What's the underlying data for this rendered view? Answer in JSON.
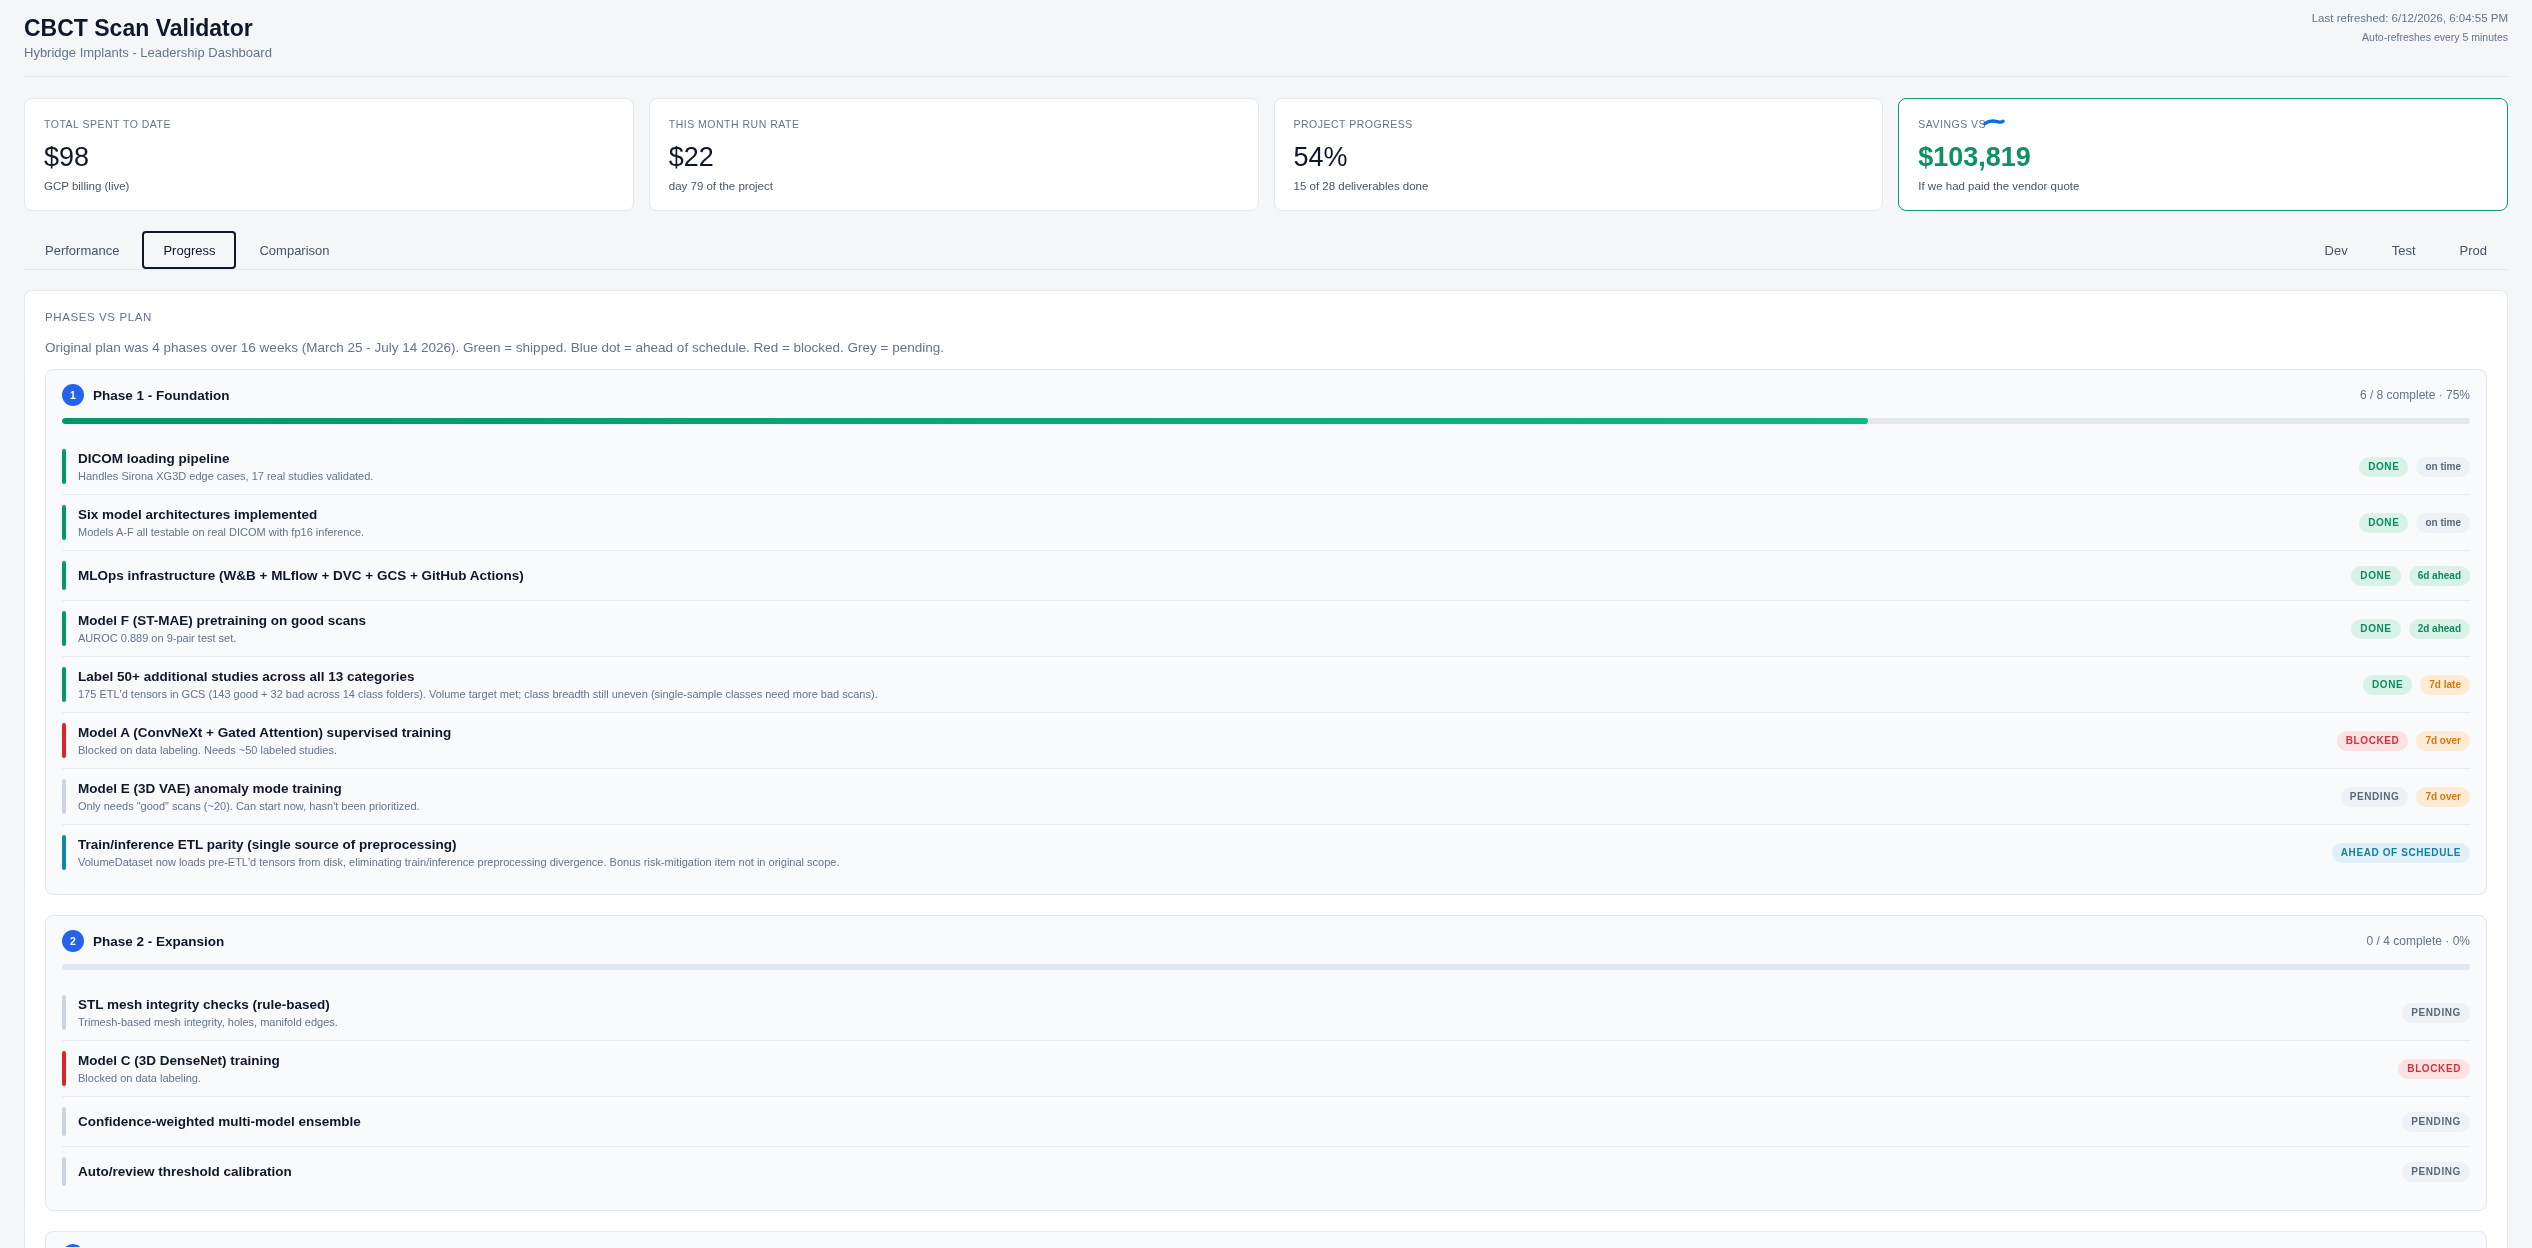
{
  "header": {
    "title": "CBCT Scan Validator",
    "subtitle": "Hybridge Implants - Leadership Dashboard",
    "last_refreshed": "Last refreshed: 6/12/2026, 6:04:55 PM",
    "auto_refresh": "Auto-refreshes every 5 minutes"
  },
  "kpis": [
    {
      "label": "TOTAL SPENT TO DATE",
      "value": "$98",
      "caption": "GCP billing (live)",
      "highlighted": false,
      "redacted": false
    },
    {
      "label": "THIS MONTH RUN RATE",
      "value": "$22",
      "caption": "day 79 of the project",
      "highlighted": false,
      "redacted": false
    },
    {
      "label": "PROJECT PROGRESS",
      "value": "54%",
      "caption": "15 of 28 deliverables done",
      "highlighted": false,
      "redacted": false
    },
    {
      "label": "SAVINGS VS",
      "value": "$103,819",
      "caption": "If we had paid the vendor quote",
      "highlighted": true,
      "redacted": true
    }
  ],
  "tabs": [
    {
      "label": "Performance",
      "selected": false
    },
    {
      "label": "Progress",
      "selected": true
    },
    {
      "label": "Comparison",
      "selected": false
    }
  ],
  "environments": [
    {
      "label": "Dev",
      "selected": false
    },
    {
      "label": "Test",
      "selected": false
    },
    {
      "label": "Prod",
      "selected": false
    }
  ],
  "progress": {
    "heading": "PHASES VS PLAN",
    "description": "Original plan was 4 phases over 16 weeks (March 25 - July 14 2026). Green = shipped. Blue dot = ahead of schedule. Red = blocked. Grey = pending.",
    "phases": [
      {
        "number": "1",
        "title": "Phase 1 - Foundation",
        "summary": "6 / 8 complete · 75%",
        "level": 0.75,
        "items": [
          {
            "title": "DICOM loading pipeline",
            "note": "Handles Sirona XG3D edge cases, 17 real studies validated.",
            "status": {
              "kind": "done",
              "label": "DONE"
            },
            "timing": {
              "kind": "neutral",
              "label": "on time"
            }
          },
          {
            "title": "Six model architectures implemented",
            "note": "Models A-F all testable on real DICOM with fp16 inference.",
            "status": {
              "kind": "done",
              "label": "DONE"
            },
            "timing": {
              "kind": "neutral",
              "label": "on time"
            }
          },
          {
            "title": "MLOps infrastructure (W&B + MLflow + DVC + GCS + GitHub Actions)",
            "status": {
              "kind": "done",
              "label": "DONE"
            },
            "timing": {
              "kind": "ahead",
              "label": "6d ahead"
            }
          },
          {
            "title": "Model F (ST-MAE) pretraining on good scans",
            "note": "AUROC 0.889 on 9-pair test set.",
            "status": {
              "kind": "done",
              "label": "DONE"
            },
            "timing": {
              "kind": "ahead",
              "label": "2d ahead"
            }
          },
          {
            "title": "Label 50+ additional studies across all 13 categories",
            "note": "175 ETL'd tensors in GCS (143 good + 32 bad across 14 class folders). Volume target met; class breadth still uneven (single-sample classes need more bad scans).",
            "status": {
              "kind": "done",
              "label": "DONE"
            },
            "timing": {
              "kind": "late",
              "label": "7d late"
            }
          },
          {
            "title": "Model A (ConvNeXt + Gated Attention) supervised training",
            "note": "Blocked on data labeling. Needs ~50 labeled studies.",
            "status": {
              "kind": "blocked",
              "label": "BLOCKED"
            },
            "timing": {
              "kind": "late",
              "label": "7d over"
            }
          },
          {
            "title": "Model E (3D VAE) anomaly mode training",
            "note": "Only needs \"good\" scans (~20). Can start now, hasn't been prioritized.",
            "status": {
              "kind": "pending",
              "label": "PENDING"
            },
            "timing": {
              "kind": "late",
              "label": "7d over"
            }
          },
          {
            "title": "Train/inference ETL parity (single source of preprocessing)",
            "note": "VolumeDataset now loads pre-ETL'd tensors from disk, eliminating train/inference preprocessing divergence. Bonus risk-mitigation item not in original scope.",
            "status": {
              "kind": "ahead",
              "label": "AHEAD OF SCHEDULE"
            }
          }
        ]
      },
      {
        "number": "2",
        "title": "Phase 2 - Expansion",
        "summary": "0 / 4 complete · 0%",
        "level": 0,
        "items": [
          {
            "title": "STL mesh integrity checks (rule-based)",
            "note": "Trimesh-based mesh integrity, holes, manifold edges.",
            "status": {
              "kind": "pending",
              "label": "PENDING"
            }
          },
          {
            "title": "Model C (3D DenseNet) training",
            "note": "Blocked on data labeling.",
            "status": {
              "kind": "blocked",
              "label": "BLOCKED"
            }
          },
          {
            "title": "Confidence-weighted multi-model ensemble",
            "status": {
              "kind": "pending",
              "label": "PENDING"
            }
          },
          {
            "title": "Auto/review threshold calibration",
            "status": {
              "kind": "pending",
              "label": "PENDING"
            }
          }
        ]
      }
    ],
    "next_phase_peek": true
  }
}
